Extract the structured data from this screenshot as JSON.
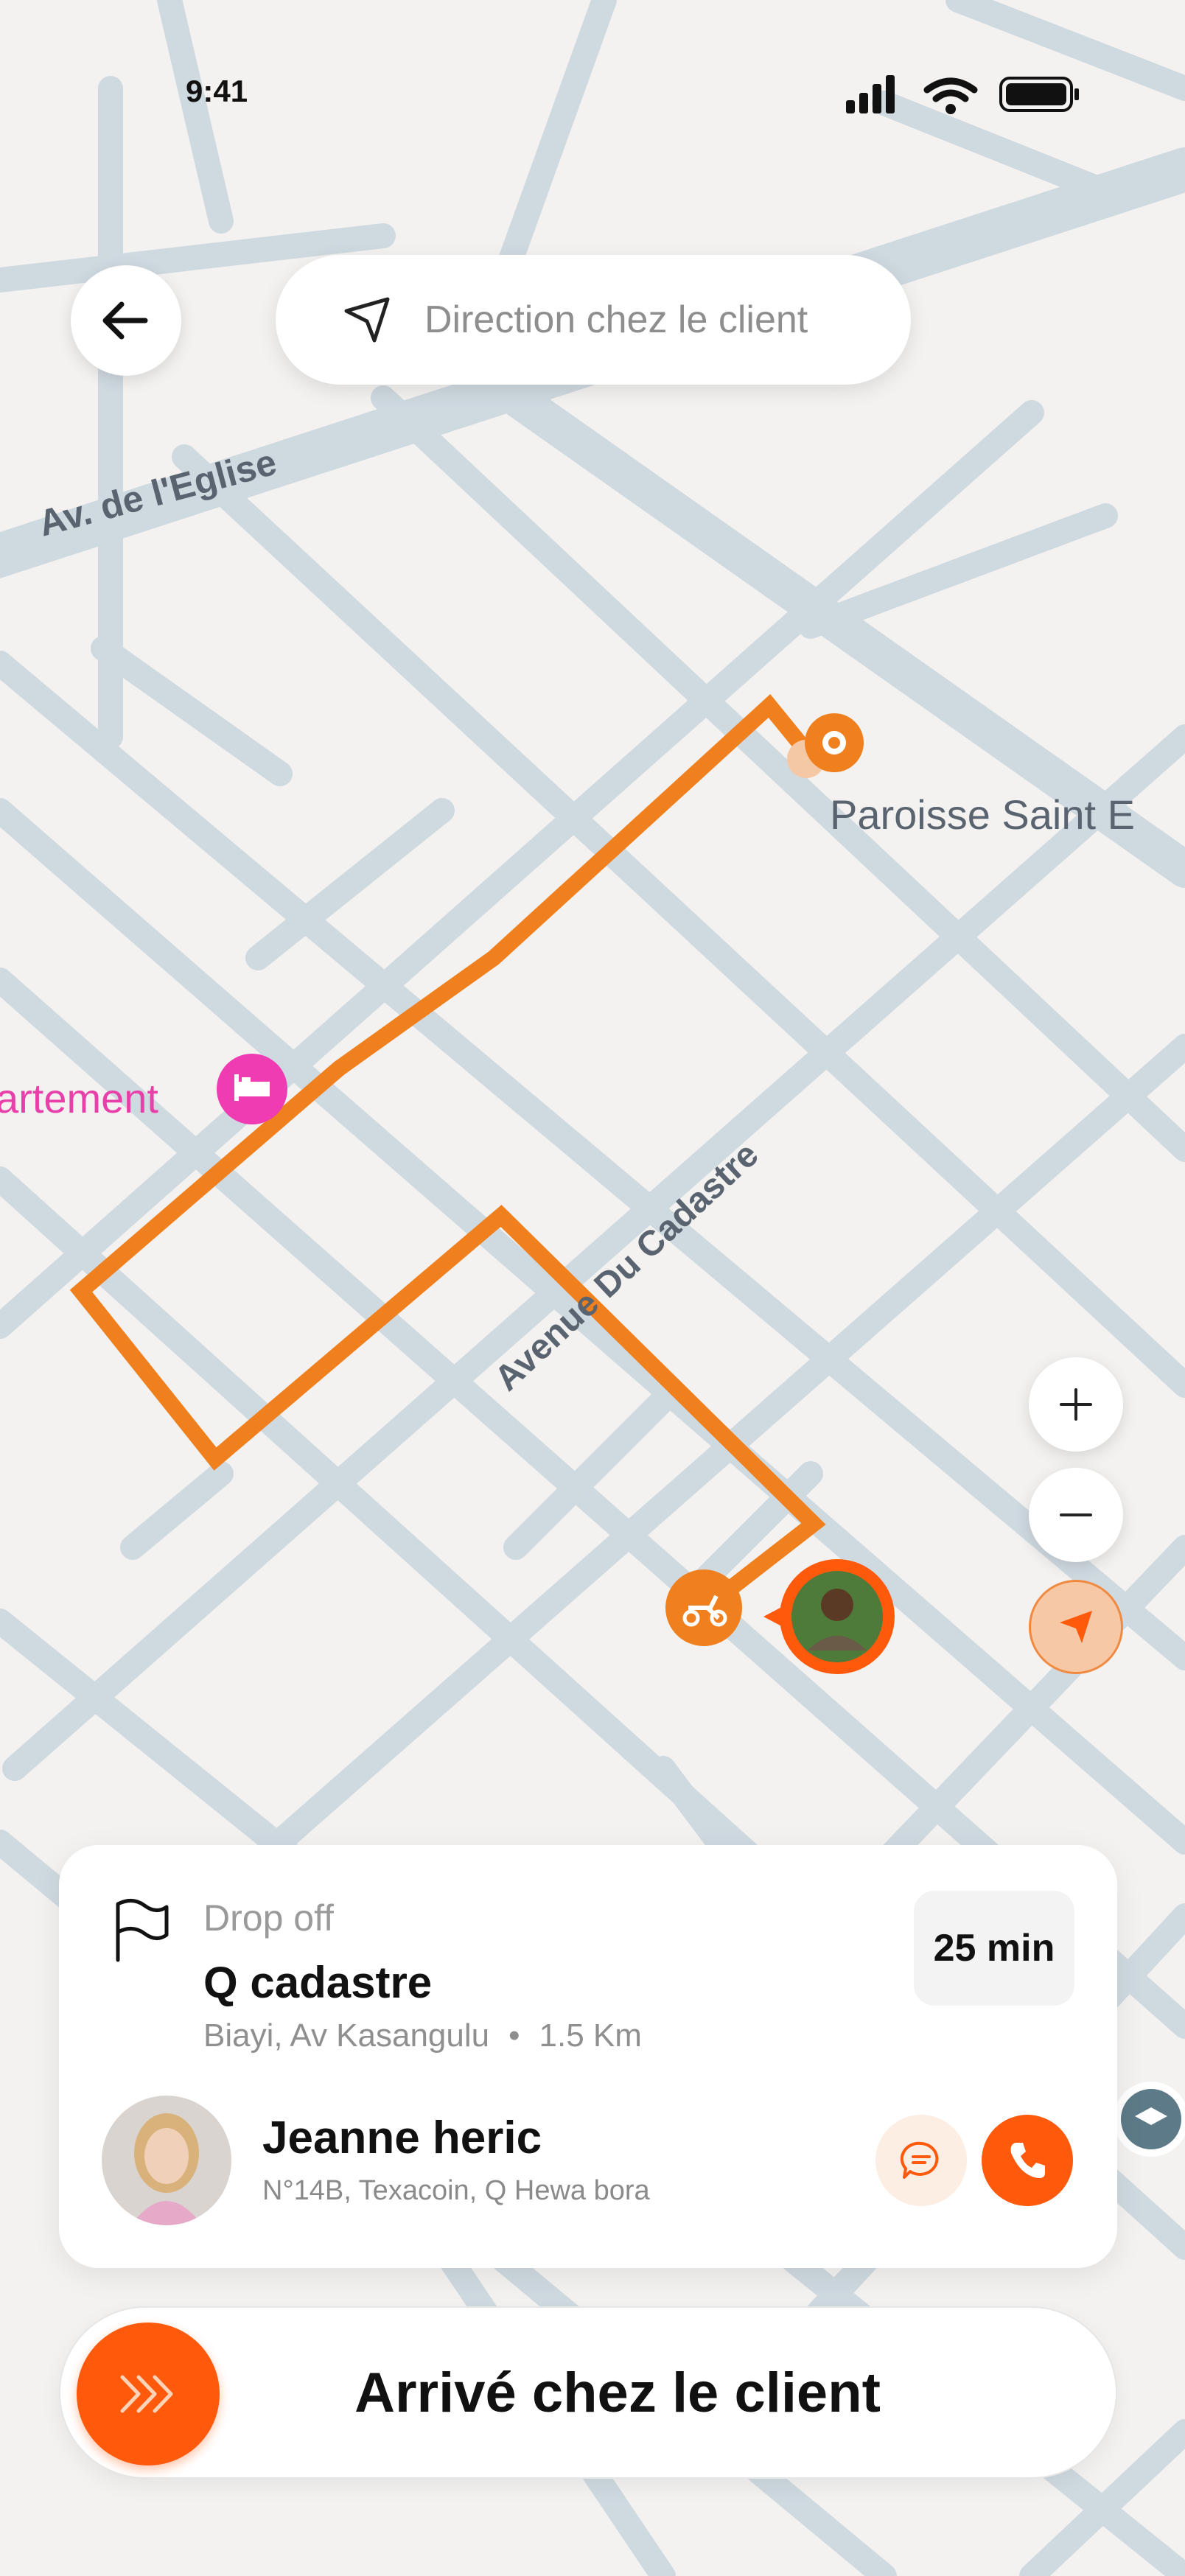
{
  "status_bar": {
    "time": "9:41"
  },
  "header": {
    "search_text": "Direction chez le client"
  },
  "map": {
    "labels": {
      "street_1": "Av. de l'Eglise",
      "street_2": "Avenue Du Cadastre",
      "poi_church": "Paroisse Saint E",
      "poi_apartment": "artement"
    },
    "route_color": "#f07f1e",
    "accent_color": "#ff5a0c"
  },
  "dropoff": {
    "label": "Drop off",
    "title": "Q cadastre",
    "address": "Biayi, Av Kasangulu",
    "distance": "1.5 Km",
    "eta": "25 min"
  },
  "client": {
    "name": "Jeanne heric",
    "address": "N°14B, Texacoin, Q Hewa bora"
  },
  "action": {
    "slider_label": "Arrivé chez le client"
  },
  "icons": [
    "back-arrow-icon",
    "navigation-arrow-icon",
    "plus-icon",
    "minus-icon",
    "locate-icon",
    "flag-icon",
    "chat-icon",
    "phone-icon",
    "chevrons-right-icon",
    "scooter-icon",
    "hotel-icon",
    "pin-icon"
  ]
}
